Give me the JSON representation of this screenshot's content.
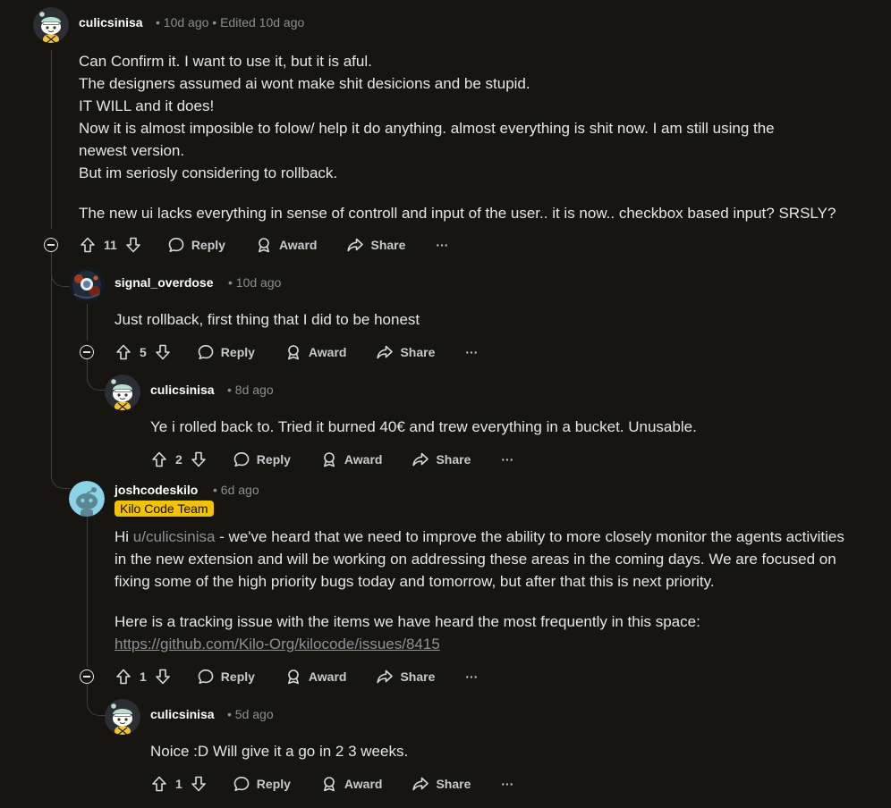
{
  "colors": {
    "background": "#161511",
    "flair_bg": "#f2c10a",
    "thread_line": "#3e4043"
  },
  "comments": [
    {
      "username": "culicsinisa",
      "meta": "• 10d ago • Edited 10d ago",
      "lines": [
        "Can Confirm it. I want to use it, but it is aful.",
        "The designers assumed ai wont make shit desicions and be stupid.",
        "IT WILL and it does!",
        "Now it is almost imposible to folow/ help it do anything. almost everything is shit now. I am still using the newest version.",
        "But im seriosly considering to rollback.",
        "The new ui lacks everything in sense of controll and input of the user.. it is now.. checkbox based input? SRSLY?"
      ],
      "votes": "11"
    },
    {
      "username": "signal_overdose",
      "meta": "• 10d ago",
      "lines": [
        "Just rollback, first thing that I did to be honest"
      ],
      "votes": "5"
    },
    {
      "username": "culicsinisa",
      "meta": "• 8d ago",
      "lines": [
        "Ye i rolled back to. Tried it burned 40€ and trew everything in a bucket. Unusable."
      ],
      "votes": "2"
    },
    {
      "username": "joshcodeskilo",
      "meta": "• 6d ago",
      "flair": "Kilo Code Team",
      "greeting": "Hi ",
      "mention": "u/culicsinisa",
      "para1_rest": " - we've heard that we need to improve the ability to more closely monitor the agents activities in the new extension and will be working on addressing these areas in the coming days. We are focused on fixing some of the high priority bugs today and tomorrow, but after that this is next priority.",
      "para2": "Here is a tracking issue with the items we have heard the most frequently in this space:",
      "link": "https://github.com/Kilo-Org/kilocode/issues/8415",
      "votes": "1"
    },
    {
      "username": "culicsinisa",
      "meta": "• 5d ago",
      "lines": [
        "Noice :D Will give it a go in 2 3 weeks."
      ],
      "votes": "1"
    }
  ],
  "actions": {
    "reply": "Reply",
    "award": "Award",
    "share": "Share",
    "more": "···"
  },
  "icons": [
    "upvote-icon",
    "downvote-icon",
    "reply-icon",
    "award-icon",
    "share-icon",
    "more-icon",
    "collapse-icon"
  ]
}
